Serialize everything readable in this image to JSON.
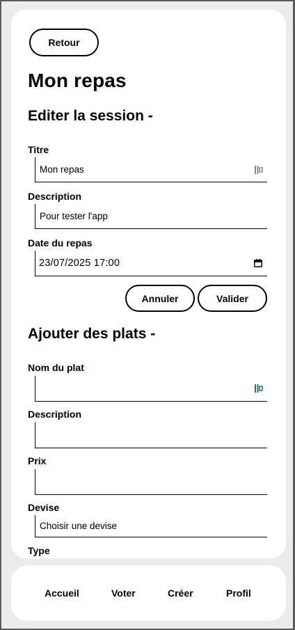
{
  "header": {
    "back_label": "Retour",
    "page_title": "Mon repas"
  },
  "edit_session": {
    "title": "Editer la session -",
    "fields": {
      "titre": {
        "label": "Titre",
        "value": "Mon repas"
      },
      "description": {
        "label": "Description",
        "value": "Pour tester l'app"
      },
      "date": {
        "label": "Date du repas",
        "value": "23/07/2025 17:00"
      }
    },
    "cancel_label": "Annuler",
    "submit_label": "Valider"
  },
  "add_dishes": {
    "title": "Ajouter des plats -",
    "fields": {
      "nom": {
        "label": "Nom du plat",
        "value": ""
      },
      "description": {
        "label": "Description",
        "value": ""
      },
      "prix": {
        "label": "Prix",
        "value": ""
      },
      "devise": {
        "label": "Devise",
        "value": "Choisir une devise"
      },
      "type": {
        "label": "Type"
      }
    }
  },
  "bottom_nav": {
    "items": [
      "Accueil",
      "Voter",
      "Créer",
      "Profil"
    ]
  },
  "icons": {
    "autofill_icon_color_inactive": "#8a8a8a",
    "autofill_icon_color_active": "#2b6c7a"
  }
}
